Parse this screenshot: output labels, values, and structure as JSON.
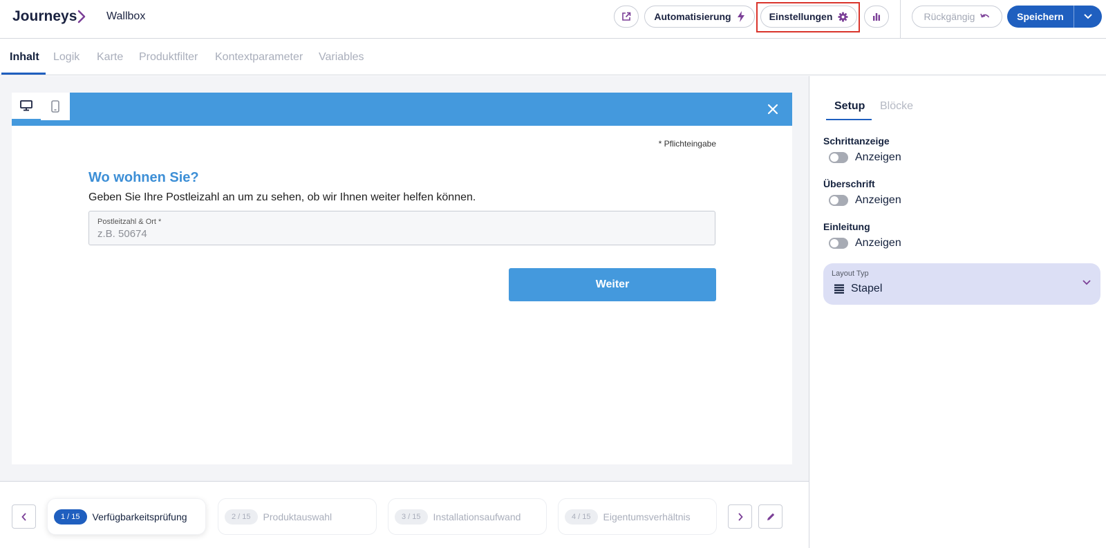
{
  "header": {
    "brand": "Journeys",
    "project": "Wallbox",
    "automation_label": "Automatisierung",
    "settings_label": "Einstellungen",
    "undo_label": "Rückgängig",
    "save_label": "Speichern"
  },
  "tabs": [
    {
      "label": "Inhalt",
      "active": true
    },
    {
      "label": "Logik"
    },
    {
      "label": "Karte"
    },
    {
      "label": "Produktfilter"
    },
    {
      "label": "Kontextparameter"
    },
    {
      "label": "Variables"
    }
  ],
  "preview": {
    "required_note": "* Pflichteingabe",
    "question_title": "Wo wohnen Sie?",
    "question_subtitle": "Geben Sie Ihre Postleizahl an um zu sehen, ob wir Ihnen weiter helfen können.",
    "field_label": "Postleitzahl & Ort *",
    "field_placeholder": "z.B. 50674",
    "next_label": "Weiter",
    "accent_color": "#4499dd"
  },
  "steps": [
    {
      "badge": "1 / 15",
      "label": "Verfügbarkeitsprüfung",
      "active": true
    },
    {
      "badge": "2 / 15",
      "label": "Produktauswahl"
    },
    {
      "badge": "3 / 15",
      "label": "Installationsaufwand"
    },
    {
      "badge": "4 / 15",
      "label": "Eigentumsverhältnis"
    }
  ],
  "panel": {
    "tabs": [
      "Setup",
      "Blöcke"
    ],
    "sections": [
      {
        "title": "Schrittanzeige",
        "toggle_label": "Anzeigen",
        "on": false
      },
      {
        "title": "Überschrift",
        "toggle_label": "Anzeigen",
        "on": false
      },
      {
        "title": "Einleitung",
        "toggle_label": "Anzeigen",
        "on": false
      }
    ],
    "layout_label": "Layout Typ",
    "layout_value": "Stapel"
  },
  "colors": {
    "primary": "#1f5fbf",
    "highlight_border": "#d9342b",
    "icon_purple": "#7b3f97"
  }
}
